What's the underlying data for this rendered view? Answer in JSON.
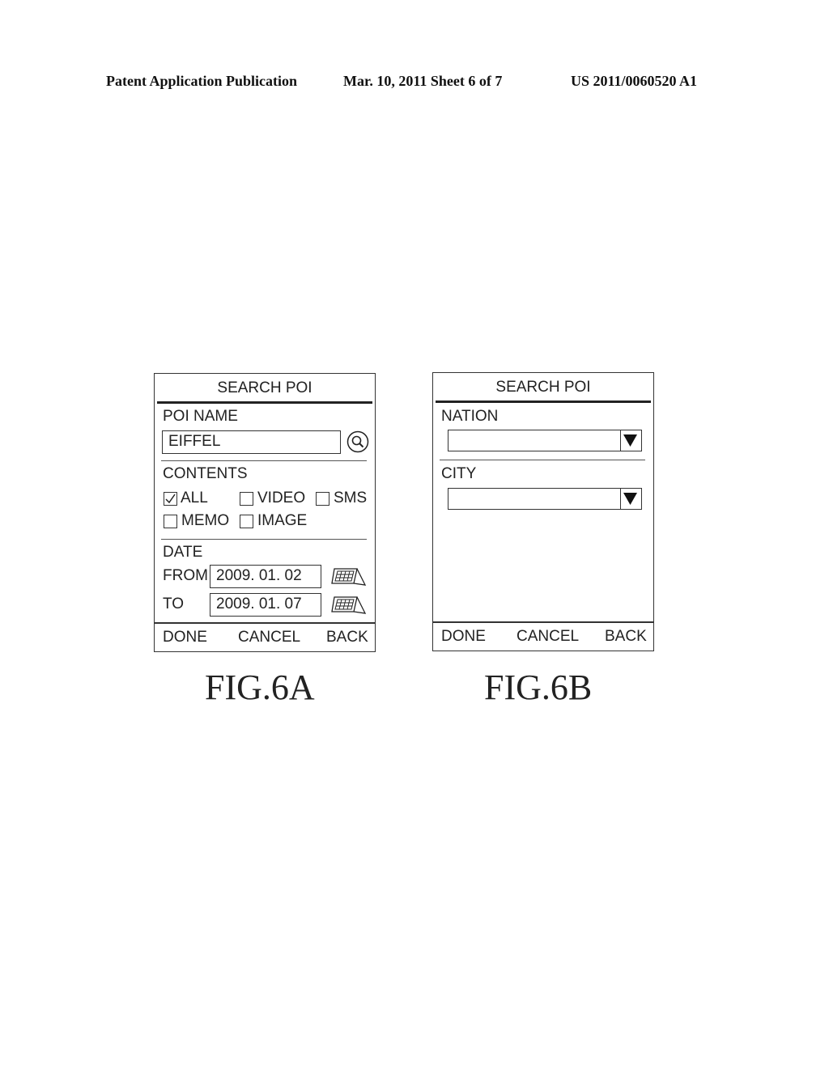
{
  "header": {
    "publication": "Patent Application Publication",
    "date_sheet": "Mar. 10, 2011  Sheet 6 of 7",
    "number": "US 2011/0060520 A1"
  },
  "fig6a": {
    "title": "SEARCH POI",
    "poi_name_label": "POI NAME",
    "poi_name_value": "EIFFEL",
    "search_icon": "magnifier-icon",
    "contents_label": "CONTENTS",
    "contents_options": [
      {
        "label": "ALL",
        "checked": true
      },
      {
        "label": "VIDEO",
        "checked": false
      },
      {
        "label": "SMS",
        "checked": false
      },
      {
        "label": "MEMO",
        "checked": false
      },
      {
        "label": "IMAGE",
        "checked": false
      }
    ],
    "date_label": "DATE",
    "from_label": "FROM",
    "from_value": "2009. 01. 02",
    "to_label": "TO",
    "to_value": "2009. 01. 07",
    "calendar_icon": "calendar-icon",
    "buttons": {
      "done": "DONE",
      "cancel": "CANCEL",
      "back": "BACK"
    },
    "caption": "FIG.6A"
  },
  "fig6b": {
    "title": "SEARCH POI",
    "nation_label": "NATION",
    "nation_value": "",
    "city_label": "CITY",
    "city_value": "",
    "dropdown_icon": "triangle-down-icon",
    "buttons": {
      "done": "DONE",
      "cancel": "CANCEL",
      "back": "BACK"
    },
    "caption": "FIG.6B"
  }
}
